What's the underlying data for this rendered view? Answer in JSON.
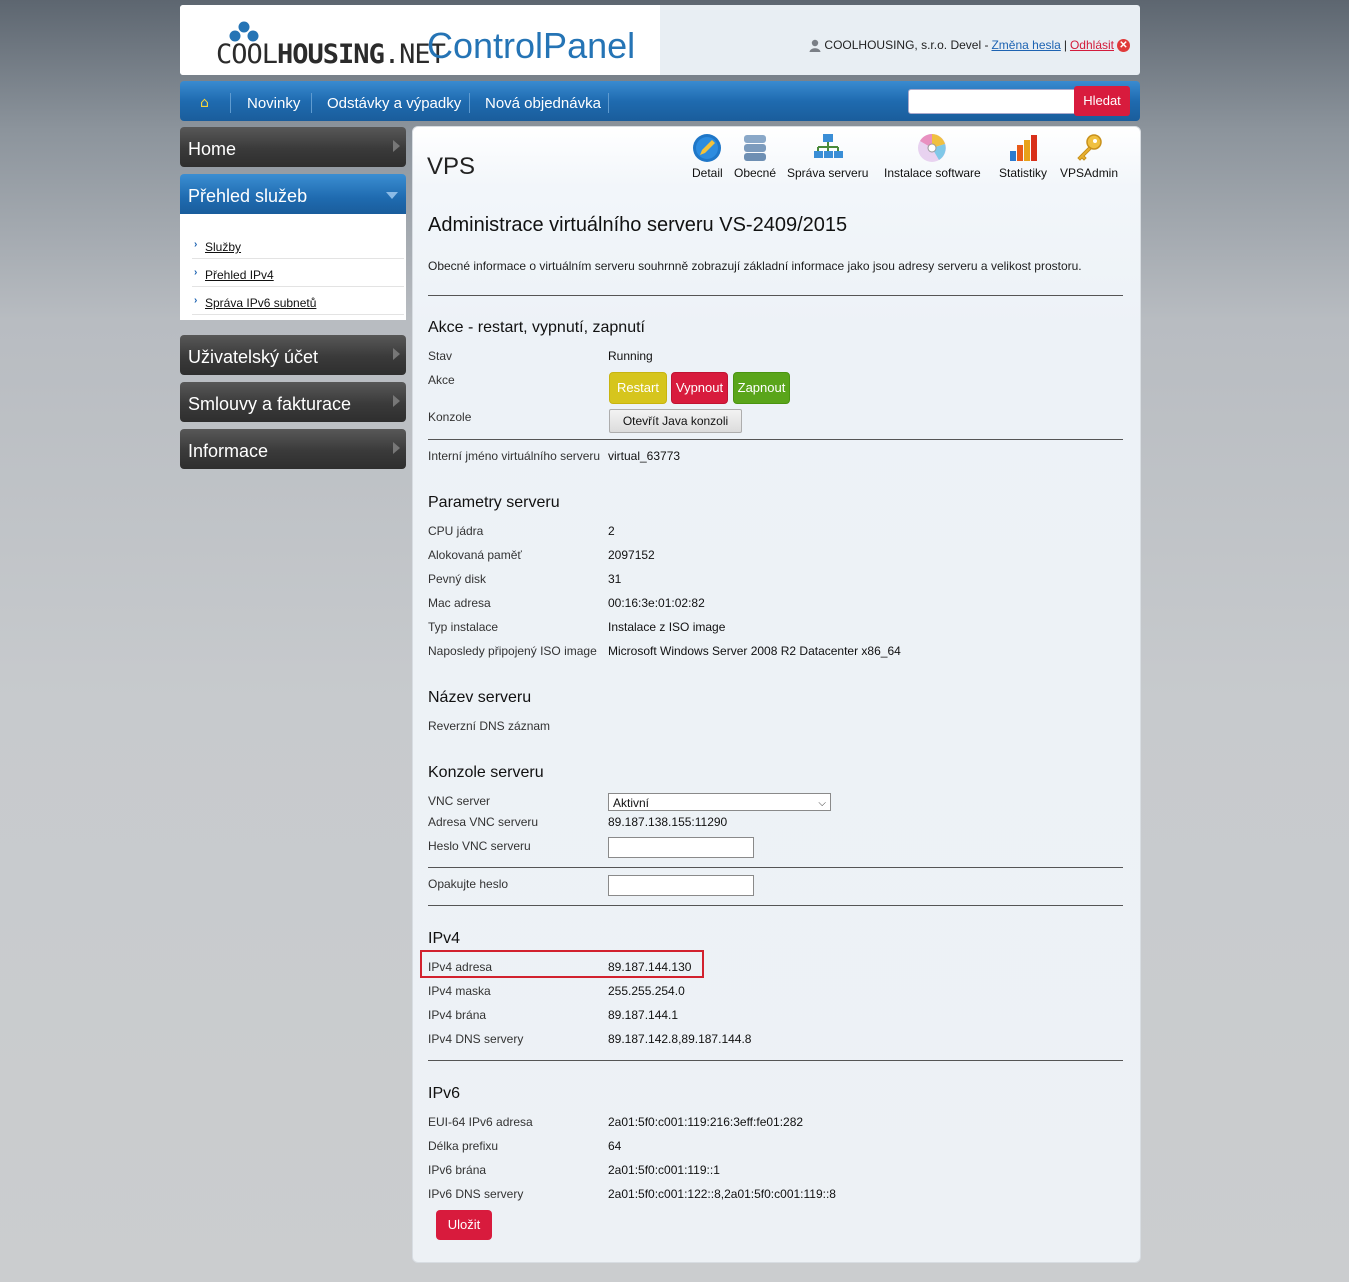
{
  "header": {
    "logo_text_cool": "COOL",
    "logo_text_housing": "HOUSING",
    "logo_text_net": ".NET",
    "app_title": "ControlPanel",
    "user_label": "COOLHOUSING, s.r.o. Devel -",
    "change_password": "Změna hesla",
    "separator": "|",
    "logout": "Odhlásit"
  },
  "nav": {
    "items": [
      "Novinky",
      "Odstávky a výpadky",
      "Nová objednávka"
    ],
    "search_button": "Hledat",
    "search_value": ""
  },
  "sidebar": {
    "home": "Home",
    "prehled": "Přehled služeb",
    "sub_items": [
      "Služby",
      "Přehled IPv4",
      "Správa IPv6 subnetů"
    ],
    "ucet": "Uživatelský účet",
    "smlouvy": "Smlouvy a fakturace",
    "informace": "Informace"
  },
  "main": {
    "title": "VPS",
    "toolbar": [
      "Detail",
      "Obecné",
      "Správa serveru",
      "Instalace software",
      "Statistiky",
      "VPSAdmin"
    ],
    "heading": "Administrace virtuálního serveru VS-2409/2015",
    "description": "Obecné informace o virtuálním serveru souhrnně zobrazují základní informace jako jsou adresy serveru a velikost prostoru.",
    "akce_heading": "Akce - restart, vypnutí, zapnutí",
    "stav_label": "Stav",
    "stav_value": "Running",
    "akce_label": "Akce",
    "btn_restart": "Restart",
    "btn_vypnout": "Vypnout",
    "btn_zapnout": "Zapnout",
    "konzole_label": "Konzole",
    "btn_java": "Otevřít Java konzoli",
    "internal_name_label": "Interní jméno virtuálního serveru",
    "internal_name_value": "virtual_63773",
    "params_heading": "Parametry serveru",
    "params": [
      {
        "label": "CPU jádra",
        "value": "2"
      },
      {
        "label": "Alokovaná paměť",
        "value": "2097152"
      },
      {
        "label": "Pevný disk",
        "value": "31"
      },
      {
        "label": "Mac adresa",
        "value": "00:16:3e:01:02:82"
      },
      {
        "label": "Typ instalace",
        "value": "Instalace z ISO image"
      },
      {
        "label": "Naposledy připojený ISO image",
        "value": "Microsoft Windows Server 2008 R2 Datacenter x86_64"
      }
    ],
    "nazev_heading": "Název serveru",
    "reverse_dns_label": "Reverzní DNS záznam",
    "konzole_heading": "Konzole serveru",
    "vnc_label": "VNC server",
    "vnc_selected": "Aktivní",
    "vnc_address_label": "Adresa VNC serveru",
    "vnc_address_value": "89.187.138.155:11290",
    "vnc_password_label": "Heslo VNC serveru",
    "vnc_repeat_label": "Opakujte heslo",
    "ipv4_heading": "IPv4",
    "ipv4": [
      {
        "label": "IPv4 adresa",
        "value": "89.187.144.130"
      },
      {
        "label": "IPv4 maska",
        "value": "255.255.254.0"
      },
      {
        "label": "IPv4 brána",
        "value": "89.187.144.1"
      },
      {
        "label": "IPv4 DNS servery",
        "value": "89.187.142.8,89.187.144.8"
      }
    ],
    "ipv6_heading": "IPv6",
    "ipv6": [
      {
        "label": "EUI-64 IPv6 adresa",
        "value": "2a01:5f0:c001:119:216:3eff:fe01:282"
      },
      {
        "label": "Délka prefixu",
        "value": "64"
      },
      {
        "label": "IPv6 brána",
        "value": "2a01:5f0:c001:119::1"
      },
      {
        "label": "IPv6 DNS servery",
        "value": "2a01:5f0:c001:122::8,2a01:5f0:c001:119::8"
      }
    ],
    "btn_save": "Uložit"
  },
  "colors": {
    "brand_blue": "#2574b5",
    "nav_blue": "#1f6bb0",
    "accent_red": "#d81b3d",
    "restart_yellow": "#d6c51d",
    "start_green": "#5aa51a",
    "highlight_red": "#d2212e"
  }
}
